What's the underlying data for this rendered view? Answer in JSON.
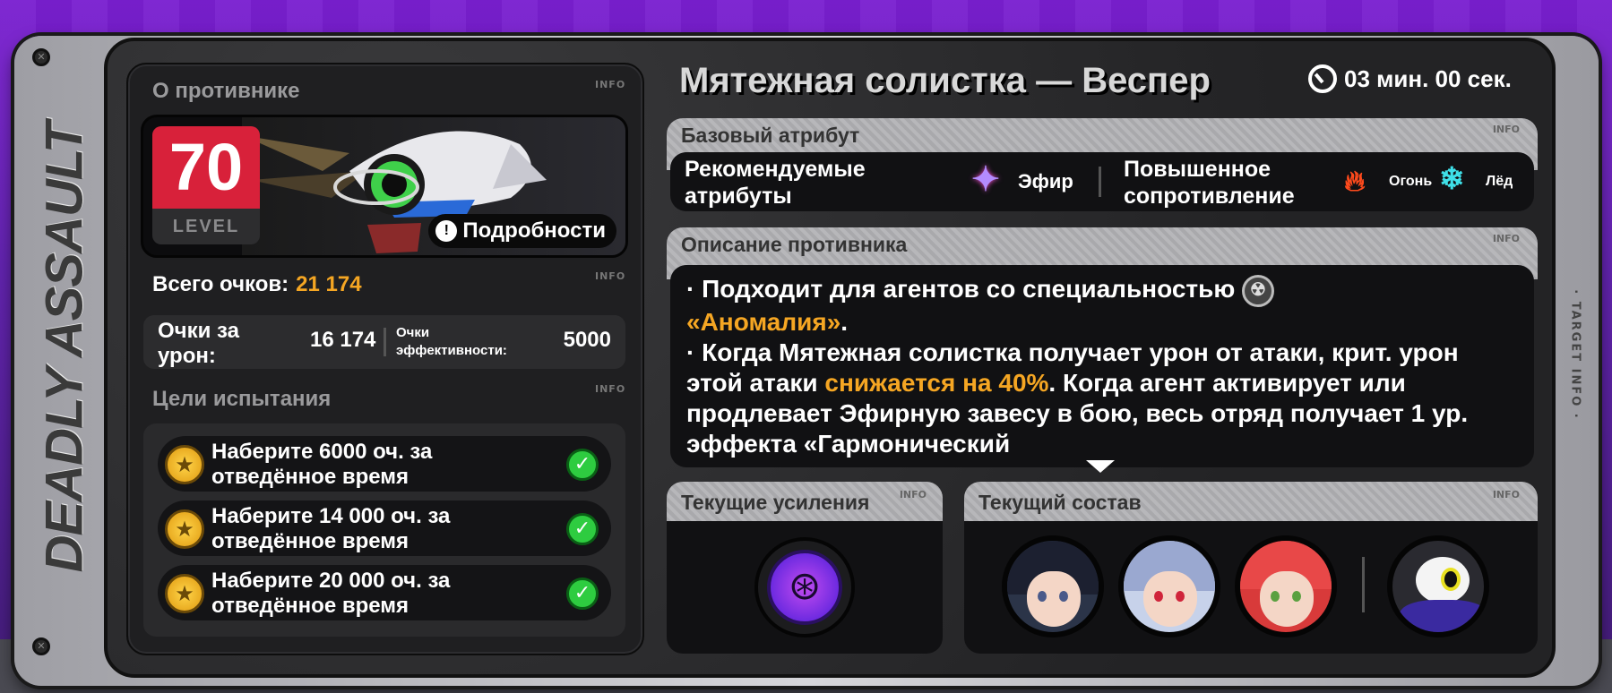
{
  "vertical_title": "DEADLY ASSAULT",
  "side_tag": "· TARGET INFO ·",
  "info_tag": "INFO",
  "left": {
    "about_header": "О противнике",
    "level_value": "70",
    "level_label": "LEVEL",
    "details_label": "Подробности",
    "total_score_label": "Всего очков:",
    "total_score_value": "21 174",
    "damage_score_label": "Очки за урон:",
    "damage_score_value": "16 174",
    "efficiency_score_label": "Очки эффективности:",
    "efficiency_score_value": "5000",
    "goals_header": "Цели испытания",
    "goals": [
      {
        "text": "Наберите 6000 оч. за отведённое время"
      },
      {
        "text": "Наберите 14 000 оч. за отведённое время"
      },
      {
        "text": "Наберите 20 000 оч. за отведённое время"
      }
    ]
  },
  "right": {
    "enemy_name": "Мятежная солистка — Веспер",
    "timer": "03 мин. 00 сек.",
    "base_attribute_header": "Базовый атрибут",
    "recommended_label": "Рекомендуемые атрибуты",
    "recommended_attr": "Эфир",
    "resistance_label": "Повышенное сопротивление",
    "resist_attr_1": "Огонь",
    "resist_attr_2": "Лёд",
    "description_header": "Описание противника",
    "desc": {
      "p1_a": "· Подходит для агентов со специальностью",
      "p1_hl": "«Аномалия»",
      "p1_end": ".",
      "p2_a": "· Когда Мятежная солистка получает урон от атаки, крит. урон этой атаки",
      "p2_hl": "снижается на 40%",
      "p2_b": ". Когда агент активирует или продлевает Эфирную завесу в бою, весь отряд получает 1 ур. эффекта «Гармонический"
    },
    "buffs_header": "Текущие усиления",
    "team_header": "Текущий состав"
  },
  "colors": {
    "accent_orange": "#f5a623",
    "level_red": "#d8213a",
    "check_green": "#2ecc40"
  },
  "icons": {
    "timer": "clock-icon",
    "ether": "ether-attribute-icon",
    "fire": "fire-attribute-icon",
    "ice": "ice-attribute-icon",
    "anomaly": "anomaly-specialty-icon",
    "goal": "star-medal-icon",
    "check": "check-icon"
  }
}
